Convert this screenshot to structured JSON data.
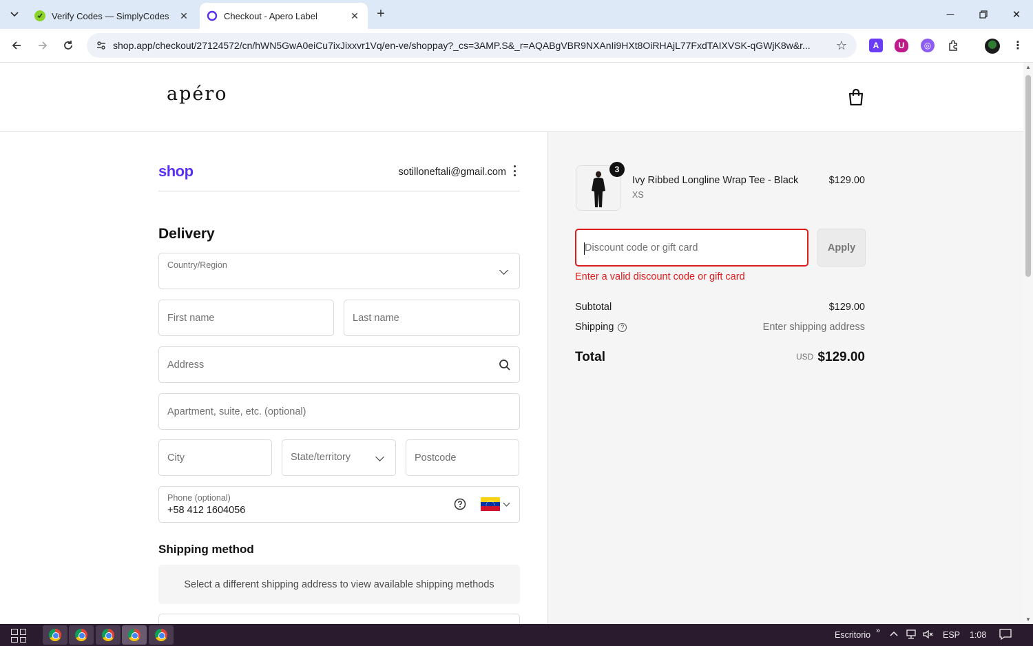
{
  "browser": {
    "tabs": [
      {
        "title": "Verify Codes — SimplyCodes",
        "active": false
      },
      {
        "title": "Checkout - Apero Label",
        "active": true
      }
    ],
    "url": "shop.app/checkout/27124572/cn/hWN5GwA0eiCu7ixJixxvr1Vq/en-ve/shoppay?_cs=3AMP.S&_r=AQABgVBR9NXAnIi9HXt8OiRHAjL77FxdTAIXVSK-qGWjK8w&r..."
  },
  "store": {
    "logo": "apéro"
  },
  "account": {
    "shop_logo": "shop",
    "email": "sotilloneftali@gmail.com"
  },
  "delivery": {
    "title": "Delivery",
    "country_label": "Country/Region",
    "first_name_placeholder": "First name",
    "last_name_placeholder": "Last name",
    "address_placeholder": "Address",
    "apartment_placeholder": "Apartment, suite, etc. (optional)",
    "city_placeholder": "City",
    "state_placeholder": "State/territory",
    "postcode_placeholder": "Postcode",
    "phone_label": "Phone (optional)",
    "phone_value": "+58 412 1604056"
  },
  "shipping_method": {
    "title": "Shipping method",
    "message": "Select a different shipping address to view available shipping methods"
  },
  "order": {
    "item": {
      "name": "Ivy Ribbed Longline Wrap Tee - Black",
      "variant": "XS",
      "price": "$129.00",
      "quantity": "3"
    },
    "discount": {
      "placeholder": "Discount code or gift card",
      "apply_label": "Apply",
      "error": "Enter a valid discount code or gift card"
    },
    "subtotal_label": "Subtotal",
    "subtotal_value": "$129.00",
    "shipping_label": "Shipping",
    "shipping_value": "Enter shipping address",
    "total_label": "Total",
    "total_currency": "USD",
    "total_value": "$129.00"
  },
  "taskbar": {
    "desktop_label": "Escritorio",
    "language": "ESP",
    "time": "1:08"
  },
  "colors": {
    "shop_purple": "#5a31f4",
    "error_red": "#dd1d1d",
    "summary_bg": "#f5f5f5"
  }
}
